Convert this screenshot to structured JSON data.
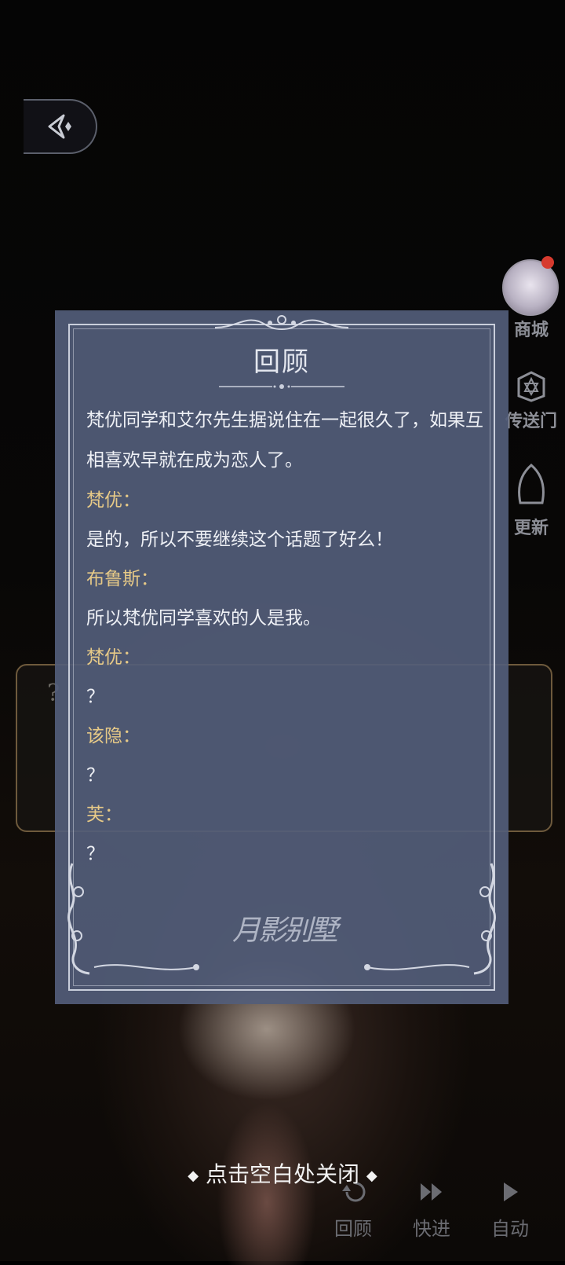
{
  "side_menu": [
    {
      "label": "商城",
      "icon": "avatar-shop-icon"
    },
    {
      "label": "传送门",
      "icon": "star-portal-icon"
    },
    {
      "label": "更新",
      "icon": "moon-update-icon"
    }
  ],
  "bottom_bar": [
    {
      "label": "回顾",
      "icon": "rewind-icon"
    },
    {
      "label": "快进",
      "icon": "fast-forward-icon"
    },
    {
      "label": "自动",
      "icon": "play-icon"
    }
  ],
  "dialogue_box": {
    "mark": "?"
  },
  "review_panel": {
    "title": "回顾",
    "entries": [
      {
        "type": "line",
        "text": "梵优同学和艾尔先生据说住在一起很久了，如果互相喜欢早就在成为恋人了。"
      },
      {
        "type": "speaker",
        "text": "梵优："
      },
      {
        "type": "line",
        "text": "是的，所以不要继续这个话题了好么！"
      },
      {
        "type": "speaker",
        "text": "布鲁斯："
      },
      {
        "type": "line",
        "text": "所以梵优同学喜欢的人是我。"
      },
      {
        "type": "speaker",
        "text": "梵优："
      },
      {
        "type": "line",
        "text": "？"
      },
      {
        "type": "speaker",
        "text": "该隐："
      },
      {
        "type": "line",
        "text": "？"
      },
      {
        "type": "speaker",
        "text": "芙："
      },
      {
        "type": "line",
        "text": "？"
      }
    ],
    "watermark": "月影别墅"
  },
  "close_hint": "点击空白处关闭",
  "colors": {
    "panel": "#525d7a",
    "speaker": "#e6c987",
    "text": "#eef0f5",
    "frame": "#c9cedb"
  }
}
